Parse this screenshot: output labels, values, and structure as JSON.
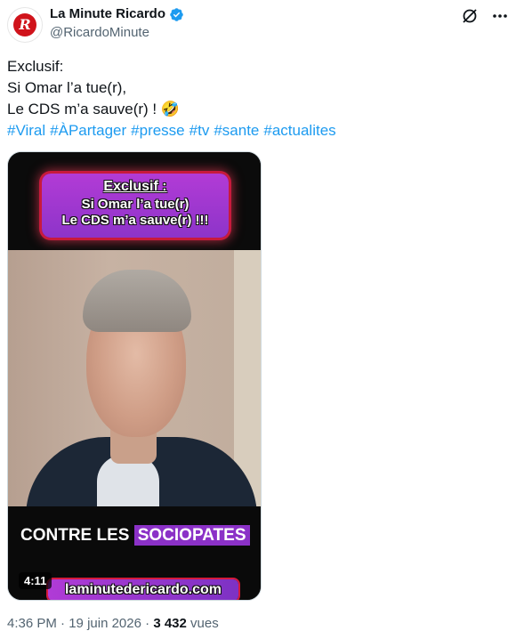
{
  "account": {
    "display_name": "La Minute Ricardo",
    "handle": "@RicardoMinute",
    "verified": true,
    "avatar_letter": "R"
  },
  "tweet": {
    "lines": [
      "Exclusif:",
      "Si Omar l’a tue(r),",
      "Le CDS m’a sauve(r) ! 🤣"
    ],
    "hashtags": [
      "#Viral",
      "#ÀPartager",
      "#presse",
      "#tv",
      "#sante",
      "#actualites"
    ]
  },
  "media": {
    "banner_line1": "Exclusif :",
    "banner_line2": "Si Omar l’a tue(r)",
    "banner_line3": "Le CDS m’a sauve(r) !!!",
    "caption_prefix": "CONTRE LES",
    "caption_highlight": "SOCIOPATES",
    "site": "laminutedericardo.com",
    "duration": "4:11"
  },
  "meta": {
    "time": "4:36 PM",
    "date": "19 juin 2026",
    "views_count": "3 432",
    "views_label": "vues",
    "separator": "·"
  },
  "icons": [
    "verified-badge-icon",
    "grok-slash-icon",
    "more-options-icon"
  ],
  "colors": {
    "link": "#1d9bf0",
    "secondary_text": "#536471",
    "verified": "#1d9bf0"
  }
}
